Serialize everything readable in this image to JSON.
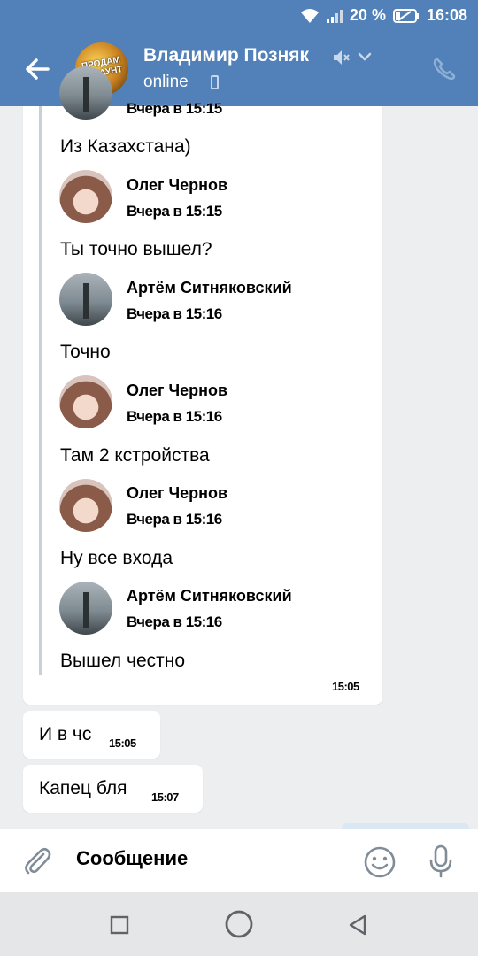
{
  "status_bar": {
    "battery": "20 %",
    "time": "16:08"
  },
  "header": {
    "title": "Владимир Позняк",
    "status": "online",
    "avatar_text": "ПРОДАМ АККАУНТ"
  },
  "forwarded": {
    "partial_time": "Вчера в 15:15",
    "first_text": "Из Казахстана)",
    "entries": [
      {
        "name": "Олег Чернов",
        "time": "Вчера в 15:15",
        "text": "Ты точно вышел?"
      },
      {
        "name": "Артём Ситняковский",
        "time": "Вчера в 15:16",
        "text": "Точно"
      },
      {
        "name": "Олег Чернов",
        "time": "Вчера в 15:16",
        "text": "Там 2 кстройства"
      },
      {
        "name": "Олег Чернов",
        "time": "Вчера в 15:16",
        "text": "Ну все входа"
      },
      {
        "name": "Артём Ситняковский",
        "time": "Вчера в 15:16",
        "text": "Вышел честно"
      }
    ],
    "stamp": "15:05"
  },
  "messages": [
    {
      "text": "И в чс",
      "time": "15:05"
    },
    {
      "text": "Капец бля",
      "time": "15:07"
    }
  ],
  "composer": {
    "placeholder": "Сообщение"
  }
}
